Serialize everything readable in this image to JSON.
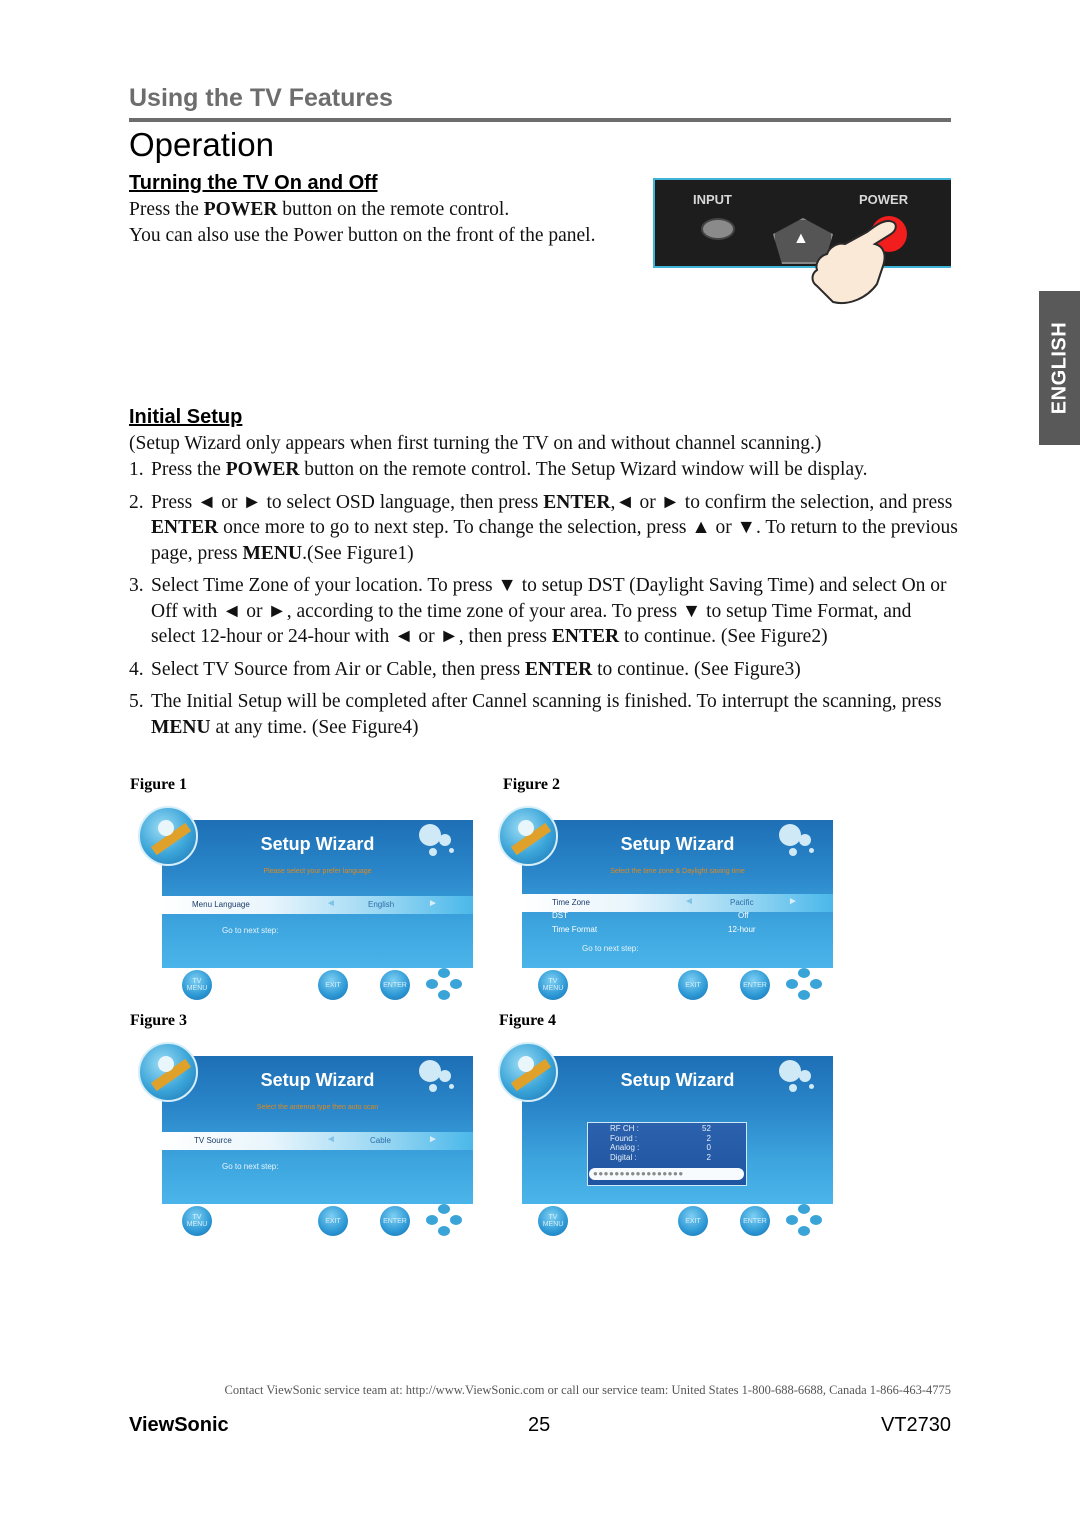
{
  "header": {
    "section": "Using the TV Features",
    "title": "Operation"
  },
  "language_tab": "ENGLISH",
  "turning_on": {
    "heading": "Turning the TV On and Off",
    "line1_pre": "Press the ",
    "line1_bold": "POWER",
    "line1_post": " button on the remote control.",
    "line2": "You can also use the Power button on the front of the panel."
  },
  "remote_image": {
    "input_label": "INPUT",
    "power_label": "POWER",
    "up_arrow": "▲",
    "colors": {
      "power": "#f21d1d",
      "frame": "#3fb3d6",
      "body": "#1d1d1d"
    }
  },
  "initial_setup": {
    "heading": "Initial Setup",
    "note": "(Setup Wizard only appears when first turning the TV on and without channel scanning.)",
    "steps": [
      {
        "num": "1.",
        "parts": [
          {
            "t": "Press the "
          },
          {
            "t": "POWER",
            "b": true
          },
          {
            "t": " button on the remote control. The Setup Wizard window will be display."
          }
        ]
      },
      {
        "num": "2.",
        "parts": [
          {
            "t": "Press ◄ or ► to select OSD language, then press "
          },
          {
            "t": "ENTER",
            "b": true
          },
          {
            "t": ",◄ or ► to confirm the selection, and press "
          },
          {
            "t": "ENTER",
            "b": true
          },
          {
            "t": " once more to go to next step. To change the selection, press ▲ or ▼. To return to the previous page, press "
          },
          {
            "t": "MENU",
            "b": true
          },
          {
            "t": ".(See Figure1)"
          }
        ]
      },
      {
        "num": "3.",
        "parts": [
          {
            "t": "Select Time Zone of your location. To press ▼ to setup DST (Daylight Saving Time) and select On or Off with ◄ or ►, according to the time zone of your area. To press ▼ to setup Time Format, and select 12-hour or 24-hour with ◄ or ►, then press "
          },
          {
            "t": "ENTER",
            "b": true
          },
          {
            "t": " to continue. (See Figure2)"
          }
        ]
      },
      {
        "num": "4.",
        "parts": [
          {
            "t": "Select TV Source from Air or Cable, then press "
          },
          {
            "t": "ENTER",
            "b": true
          },
          {
            "t": " to continue. (See Figure3)"
          }
        ]
      },
      {
        "num": "5.",
        "parts": [
          {
            "t": "The Initial Setup will be completed after Cannel scanning is finished. To interrupt the scanning, press "
          },
          {
            "t": "MENU",
            "b": true
          },
          {
            "t": " at any time. (See Figure4)"
          }
        ]
      }
    ]
  },
  "figures": [
    {
      "caption": "Figure 1",
      "title": "Setup Wizard",
      "prompt": "Please select your prefer language",
      "rows": [
        {
          "label": "Menu Language",
          "value": "English",
          "highlight": true
        }
      ],
      "next": "Go to next step:"
    },
    {
      "caption": "Figure 2",
      "title": "Setup Wizard",
      "prompt": "Select the time zone & Daylight saving time",
      "rows": [
        {
          "label": "Time Zone",
          "value": "Pacific",
          "highlight": true
        },
        {
          "label": "DST",
          "value": "Off"
        },
        {
          "label": "Time Format",
          "value": "12-hour"
        }
      ],
      "next": "Go to next step:"
    },
    {
      "caption": "Figure 3",
      "title": "Setup Wizard",
      "prompt": "Select the antenna type then auto scan",
      "rows": [
        {
          "label": "TV Source",
          "value": "Cable",
          "highlight": true
        }
      ],
      "next": "Go to next step:"
    },
    {
      "caption": "Figure 4",
      "title": "Setup Wizard",
      "scan": [
        {
          "label": "RF CH :",
          "value": "52"
        },
        {
          "label": "Found :",
          "value": "2"
        },
        {
          "label": "Analog :",
          "value": "0"
        },
        {
          "label": "Digital :",
          "value": "2"
        }
      ],
      "progress_dots": "●●●●●●●●●●●●●●●●●"
    }
  ],
  "wizard_buttons": {
    "menu": "TV MENU",
    "exit": "EXIT",
    "enter": "ENTER"
  },
  "footer": {
    "contact": "Contact ViewSonic service team at: http://www.ViewSonic.com or call our service team: United States 1-800-688-6688, Canada 1-866-463-4775",
    "brand": "ViewSonic",
    "page": "25",
    "model": "VT2730"
  }
}
